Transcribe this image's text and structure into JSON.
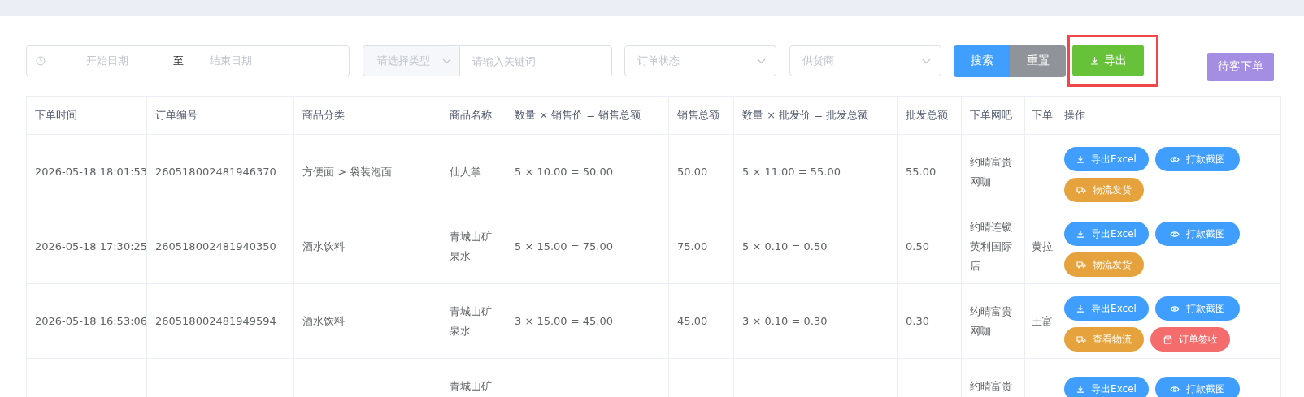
{
  "filters": {
    "date_range": {
      "start_placeholder": "开始日期",
      "separator": "至",
      "end_placeholder": "结束日期"
    },
    "type_select": {
      "placeholder": "请选择类型"
    },
    "keyword": {
      "placeholder": "请输入关键词"
    },
    "order_status": {
      "placeholder": "订单状态"
    },
    "supplier": {
      "placeholder": "供货商"
    }
  },
  "buttons": [
    {
      "label": "搜索",
      "kind": "search",
      "highlighted": false
    },
    {
      "label": "重置",
      "kind": "reset",
      "highlighted": false
    },
    {
      "label": "导出",
      "kind": "export",
      "highlighted": true
    }
  ],
  "guest_order_button": "待客下单",
  "table": {
    "columns": [
      "下单时间",
      "订单编号",
      "商品分类",
      "商品名称",
      "数量 × 销售价 = 销售总额",
      "销售总额",
      "数量 × 批发价 = 批发总额",
      "批发总额",
      "下单网吧",
      "下单",
      "操作"
    ],
    "rows": [
      {
        "cells": [
          "2026-05-18 18:01:53",
          "260518002481946370",
          "方便面 > 袋装泡面",
          "仙人掌",
          "5 × 10.00 = 50.00",
          "50.00",
          "5 × 11.00 = 55.00",
          "55.00",
          "约晴富贵网咖",
          ""
        ],
        "actions": [
          {
            "label": "导出Excel",
            "kind": "export"
          },
          {
            "label": "打款截图",
            "kind": "view"
          },
          {
            "label": "物流发货",
            "kind": "ship"
          }
        ]
      },
      {
        "cells": [
          "2026-05-18 17:30:25",
          "260518002481940350",
          "酒水饮料",
          "青城山矿泉水",
          "5 × 15.00 = 75.00",
          "75.00",
          "5 × 0.10 = 0.50",
          "0.50",
          "约晴连锁英利国际店",
          "黄拉"
        ],
        "actions": [
          {
            "label": "导出Excel",
            "kind": "export"
          },
          {
            "label": "打款截图",
            "kind": "view"
          },
          {
            "label": "物流发货",
            "kind": "ship"
          }
        ]
      },
      {
        "cells": [
          "2026-05-18 16:53:06",
          "260518002481949594",
          "酒水饮料",
          "青城山矿泉水",
          "3 × 15.00 = 45.00",
          "45.00",
          "3 × 0.10 = 0.30",
          "0.30",
          "约晴富贵网咖",
          "王富"
        ],
        "actions": [
          {
            "label": "导出Excel",
            "kind": "export"
          },
          {
            "label": "打款截图",
            "kind": "view"
          },
          {
            "label": "查看物流",
            "kind": "track"
          },
          {
            "label": "订单签收",
            "kind": "receive"
          }
        ]
      },
      {
        "cells": [
          "",
          "",
          "",
          "青城山矿",
          "",
          "",
          "",
          "",
          "约晴富贵",
          ""
        ],
        "actions": [
          {
            "label": "导出Excel",
            "kind": "export"
          },
          {
            "label": "打款截图",
            "kind": "view"
          }
        ]
      }
    ]
  }
}
